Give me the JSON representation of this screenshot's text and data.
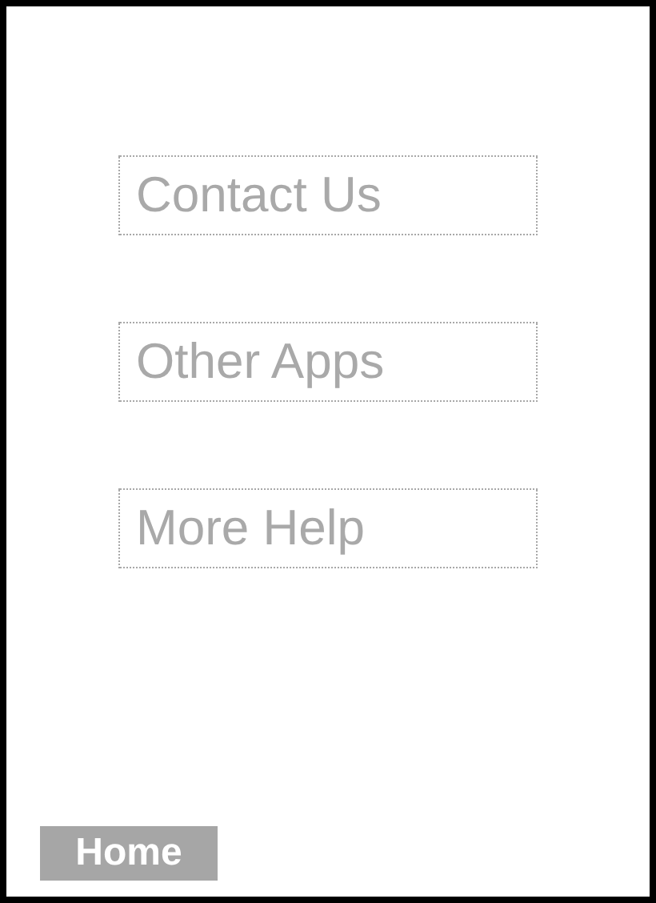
{
  "menu_buttons": [
    {
      "label": "Contact Us"
    },
    {
      "label": "Other Apps"
    },
    {
      "label": "More Help"
    }
  ],
  "home_button": {
    "label": "Home"
  }
}
